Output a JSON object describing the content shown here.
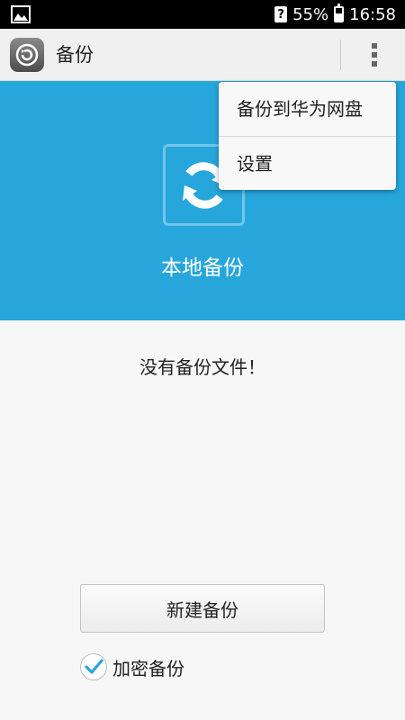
{
  "status_bar": {
    "left_icon": "image-icon",
    "sim_icon": "sim-unknown-icon",
    "sim_glyph": "?",
    "battery_percent": "55%",
    "battery_level": 0.55,
    "time": "16:58"
  },
  "action_bar": {
    "app_icon": "backup-restore-icon",
    "title": "备份",
    "overflow_icon": "overflow-menu-icon"
  },
  "hero": {
    "icon": "sync-arrows-icon",
    "label": "本地备份",
    "background_color": "#27a6dc"
  },
  "main": {
    "empty_message": "没有备份文件！",
    "new_backup_label": "新建备份",
    "encrypt": {
      "label": "加密备份",
      "checked": true,
      "check_color": "#27a6dc"
    }
  },
  "menu": {
    "items": [
      {
        "label": "备份到华为网盘"
      },
      {
        "label": "设置"
      }
    ]
  }
}
